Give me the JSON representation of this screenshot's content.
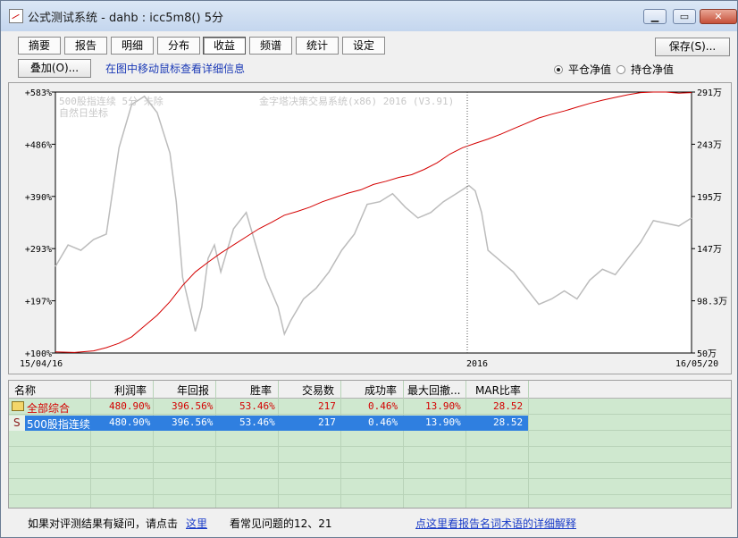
{
  "window": {
    "title": "公式测试系统 - dahb : icc5m8() 5分",
    "min": "▁",
    "max": "▭",
    "close": "✕"
  },
  "tabs": [
    {
      "label": "摘要"
    },
    {
      "label": "报告"
    },
    {
      "label": "明细"
    },
    {
      "label": "分布"
    },
    {
      "label": "收益",
      "active": true
    },
    {
      "label": "频谱"
    },
    {
      "label": "统计"
    },
    {
      "label": "设定"
    }
  ],
  "save_label": "保存(S)...",
  "overlay_label": "叠加(O)...",
  "hint": "在图中移动鼠标查看详细信息",
  "radios": [
    {
      "label": "平仓净值",
      "checked": true
    },
    {
      "label": "持仓净值",
      "checked": false
    }
  ],
  "chart_data": {
    "type": "line",
    "overlay_text": [
      "500股指连续 5分 未除",
      "自然日坐标"
    ],
    "watermark": "金字塔决策交易系统(x86) 2016 (V3.91)",
    "left_ticks": [
      "+583%",
      "+486%",
      "+390%",
      "+293%",
      "+197%",
      "+100%"
    ],
    "right_ticks": [
      "291万",
      "243万",
      "195万",
      "147万",
      "98.3万",
      "50万"
    ],
    "x_labels": [
      "15/04/16",
      "2016",
      "16/05/20"
    ],
    "ylim_left": [
      100,
      583
    ],
    "ylim_right": [
      50,
      291
    ],
    "series": [
      {
        "color": "#d40000",
        "points": [
          [
            0.0,
            102
          ],
          [
            0.03,
            101
          ],
          [
            0.06,
            104
          ],
          [
            0.08,
            110
          ],
          [
            0.1,
            118
          ],
          [
            0.12,
            130
          ],
          [
            0.14,
            150
          ],
          [
            0.16,
            170
          ],
          [
            0.18,
            195
          ],
          [
            0.2,
            225
          ],
          [
            0.22,
            250
          ],
          [
            0.24,
            268
          ],
          [
            0.26,
            285
          ],
          [
            0.28,
            300
          ],
          [
            0.3,
            315
          ],
          [
            0.32,
            330
          ],
          [
            0.34,
            342
          ],
          [
            0.36,
            355
          ],
          [
            0.38,
            362
          ],
          [
            0.4,
            370
          ],
          [
            0.42,
            380
          ],
          [
            0.44,
            388
          ],
          [
            0.46,
            396
          ],
          [
            0.48,
            402
          ],
          [
            0.5,
            412
          ],
          [
            0.52,
            418
          ],
          [
            0.54,
            425
          ],
          [
            0.56,
            430
          ],
          [
            0.58,
            440
          ],
          [
            0.6,
            452
          ],
          [
            0.62,
            468
          ],
          [
            0.64,
            480
          ],
          [
            0.66,
            488
          ],
          [
            0.68,
            496
          ],
          [
            0.7,
            505
          ],
          [
            0.72,
            515
          ],
          [
            0.74,
            525
          ],
          [
            0.76,
            535
          ],
          [
            0.78,
            542
          ],
          [
            0.8,
            548
          ],
          [
            0.82,
            555
          ],
          [
            0.84,
            562
          ],
          [
            0.86,
            568
          ],
          [
            0.88,
            573
          ],
          [
            0.9,
            578
          ],
          [
            0.92,
            582
          ],
          [
            0.94,
            583
          ],
          [
            0.96,
            583
          ],
          [
            0.98,
            581
          ],
          [
            1.0,
            582
          ]
        ]
      },
      {
        "color": "#bcbcbc",
        "points": [
          [
            0.0,
            260
          ],
          [
            0.02,
            300
          ],
          [
            0.04,
            290
          ],
          [
            0.06,
            310
          ],
          [
            0.08,
            320
          ],
          [
            0.1,
            480
          ],
          [
            0.12,
            560
          ],
          [
            0.14,
            575
          ],
          [
            0.16,
            545
          ],
          [
            0.18,
            470
          ],
          [
            0.19,
            380
          ],
          [
            0.2,
            240
          ],
          [
            0.21,
            190
          ],
          [
            0.22,
            140
          ],
          [
            0.23,
            185
          ],
          [
            0.24,
            275
          ],
          [
            0.25,
            300
          ],
          [
            0.26,
            250
          ],
          [
            0.28,
            330
          ],
          [
            0.3,
            360
          ],
          [
            0.31,
            320
          ],
          [
            0.33,
            240
          ],
          [
            0.35,
            185
          ],
          [
            0.36,
            135
          ],
          [
            0.37,
            160
          ],
          [
            0.39,
            200
          ],
          [
            0.41,
            220
          ],
          [
            0.43,
            250
          ],
          [
            0.45,
            290
          ],
          [
            0.47,
            320
          ],
          [
            0.49,
            375
          ],
          [
            0.51,
            380
          ],
          [
            0.53,
            395
          ],
          [
            0.55,
            370
          ],
          [
            0.57,
            350
          ],
          [
            0.59,
            360
          ],
          [
            0.61,
            380
          ],
          [
            0.63,
            395
          ],
          [
            0.65,
            410
          ],
          [
            0.66,
            400
          ],
          [
            0.67,
            360
          ],
          [
            0.68,
            290
          ],
          [
            0.7,
            270
          ],
          [
            0.72,
            250
          ],
          [
            0.74,
            220
          ],
          [
            0.76,
            190
          ],
          [
            0.78,
            200
          ],
          [
            0.8,
            215
          ],
          [
            0.82,
            200
          ],
          [
            0.84,
            235
          ],
          [
            0.86,
            255
          ],
          [
            0.88,
            245
          ],
          [
            0.9,
            275
          ],
          [
            0.92,
            305
          ],
          [
            0.94,
            345
          ],
          [
            0.96,
            340
          ],
          [
            0.98,
            335
          ],
          [
            1.0,
            350
          ]
        ]
      }
    ]
  },
  "table": {
    "headers": [
      "名称",
      "利润率",
      "年回报",
      "胜率",
      "交易数",
      "成功率",
      "最大回撤...",
      "MAR比率"
    ],
    "rows": [
      {
        "icon": "folder-icon",
        "name": "全部综合",
        "values": [
          "480.90%",
          "396.56%",
          "53.46%",
          "217",
          "0.46%",
          "13.90%",
          "28.52"
        ],
        "color": "#d40000",
        "selected": false
      },
      {
        "icon": "S",
        "name": "500股指连续",
        "values": [
          "480.90%",
          "396.56%",
          "53.46%",
          "217",
          "0.46%",
          "13.90%",
          "28.52"
        ],
        "color": "#ffffff",
        "selected": true
      }
    ]
  },
  "footer": {
    "question": "如果对评测结果有疑问，请点击",
    "here_link": "这里",
    "faq": "看常见问题的12、21",
    "explain_link": "点这里看报告名词术语的详细解释"
  }
}
